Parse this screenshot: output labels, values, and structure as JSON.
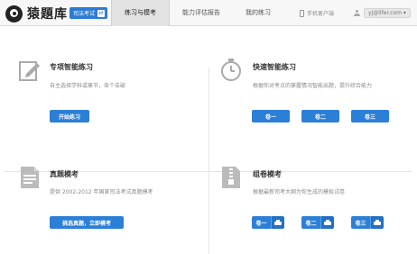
{
  "header": {
    "logo_text": "猿題库",
    "exam_badge": "司法考试",
    "exam_swap": "⇄",
    "nav": [
      "练习与模考",
      "能力评估报告",
      "我的练习"
    ],
    "mobile_label": "手机客户端",
    "user_name": "yj@lifer.com ▾"
  },
  "cards": {
    "special": {
      "title": "专项智能练习",
      "desc": "自主选择学科或章节，各个击破",
      "button": "开始练习"
    },
    "quick": {
      "title": "快速智能练习",
      "desc": "根据你对考点的掌握情况智能出题，提升综合能力",
      "buttons": [
        "卷一",
        "卷二",
        "卷三"
      ]
    },
    "real": {
      "title": "真题模考",
      "desc": "提供 2002-2012 年国家司法考试真题模考",
      "button": "挑选真题，立即模考"
    },
    "mock": {
      "title": "组卷模考",
      "desc": "根据最新司考大纲为你生成的模拟试卷",
      "buttons": [
        "卷一",
        "卷二",
        "卷三"
      ]
    }
  },
  "colors": {
    "accent": "#2c7fd6",
    "exam_badge": "#2d7bd4"
  }
}
